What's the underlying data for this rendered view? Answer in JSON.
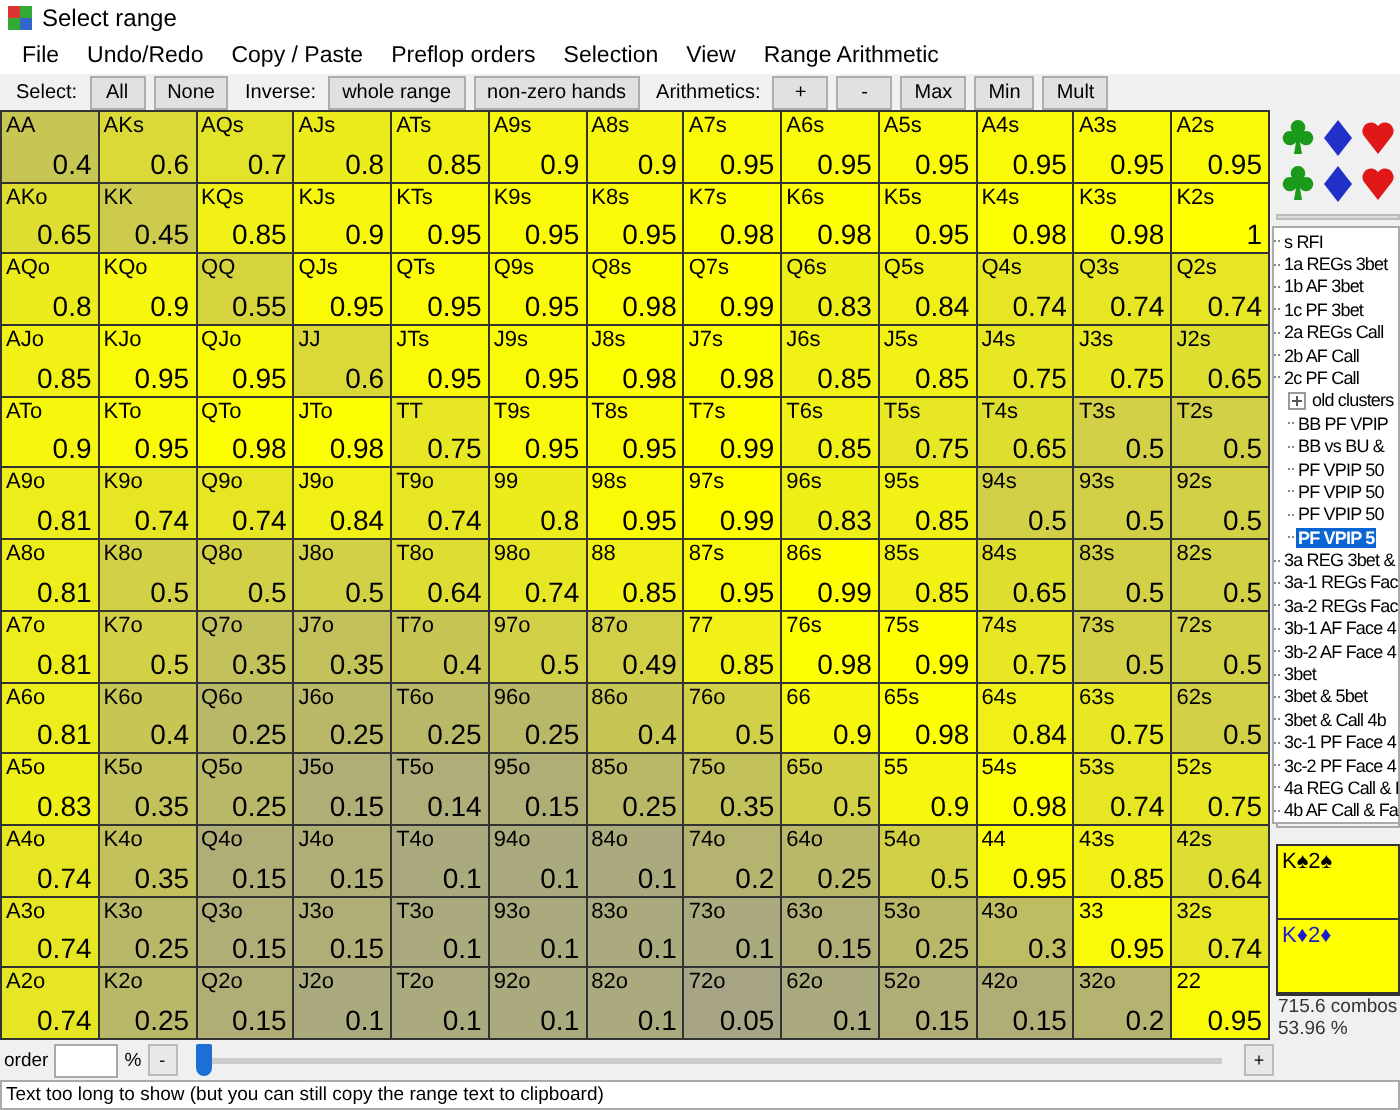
{
  "window": {
    "title": "Select range"
  },
  "menu": [
    "File",
    "Undo/Redo",
    "Copy / Paste",
    "Preflop orders",
    "Selection",
    "View",
    "Range Arithmetic"
  ],
  "toolbar": [
    {
      "label": "Select:",
      "buttons": [
        "All",
        "None"
      ]
    },
    {
      "label": "Inverse:",
      "buttons": [
        "whole range",
        "non-zero hands"
      ]
    },
    {
      "label": "Arithmetics:",
      "buttons": [
        "+",
        "-",
        "Max",
        "Min",
        "Mult"
      ]
    }
  ],
  "grid": [
    [
      {
        "hand": "AA",
        "weight": "0.4",
        "color": "#c7c654"
      },
      {
        "hand": "AKs",
        "weight": "0.6",
        "color": "#dad938"
      },
      {
        "hand": "AQs",
        "weight": "0.7",
        "color": "#e3e32a"
      },
      {
        "hand": "AJs",
        "weight": "0.8",
        "color": "#ecec1c"
      },
      {
        "hand": "ATs",
        "weight": "0.85",
        "color": "#f1f115"
      },
      {
        "hand": "A9s",
        "weight": "0.9",
        "color": "#f6f60e"
      },
      {
        "hand": "A8s",
        "weight": "0.9",
        "color": "#f6f60e"
      },
      {
        "hand": "A7s",
        "weight": "0.95",
        "color": "#fafa07"
      },
      {
        "hand": "A6s",
        "weight": "0.95",
        "color": "#fafa07"
      },
      {
        "hand": "A5s",
        "weight": "0.95",
        "color": "#fafa07"
      },
      {
        "hand": "A4s",
        "weight": "0.95",
        "color": "#fafa07"
      },
      {
        "hand": "A3s",
        "weight": "0.95",
        "color": "#fafa07"
      },
      {
        "hand": "A2s",
        "weight": "0.95",
        "color": "#fafa07"
      }
    ],
    [
      {
        "hand": "AKo",
        "weight": "0.65",
        "color": "#dede31"
      },
      {
        "hand": "KK",
        "weight": "0.45",
        "color": "#cccb4d"
      },
      {
        "hand": "KQs",
        "weight": "0.85",
        "color": "#f1f115"
      },
      {
        "hand": "KJs",
        "weight": "0.9",
        "color": "#f6f60e"
      },
      {
        "hand": "KTs",
        "weight": "0.95",
        "color": "#fafa07"
      },
      {
        "hand": "K9s",
        "weight": "0.95",
        "color": "#fafa07"
      },
      {
        "hand": "K8s",
        "weight": "0.95",
        "color": "#fafa07"
      },
      {
        "hand": "K7s",
        "weight": "0.98",
        "color": "#fdfd03"
      },
      {
        "hand": "K6s",
        "weight": "0.98",
        "color": "#fdfd03"
      },
      {
        "hand": "K5s",
        "weight": "0.95",
        "color": "#fafa07"
      },
      {
        "hand": "K4s",
        "weight": "0.98",
        "color": "#fdfd03"
      },
      {
        "hand": "K3s",
        "weight": "0.98",
        "color": "#fdfd03"
      },
      {
        "hand": "K2s",
        "weight": "1",
        "color": "#ffff00"
      }
    ],
    [
      {
        "hand": "AQo",
        "weight": "0.8",
        "color": "#ecec1c"
      },
      {
        "hand": "KQo",
        "weight": "0.9",
        "color": "#f6f60e"
      },
      {
        "hand": "QQ",
        "weight": "0.55",
        "color": "#d5d43f"
      },
      {
        "hand": "QJs",
        "weight": "0.95",
        "color": "#fafa07"
      },
      {
        "hand": "QTs",
        "weight": "0.95",
        "color": "#fafa07"
      },
      {
        "hand": "Q9s",
        "weight": "0.95",
        "color": "#fafa07"
      },
      {
        "hand": "Q8s",
        "weight": "0.98",
        "color": "#fdfd03"
      },
      {
        "hand": "Q7s",
        "weight": "0.99",
        "color": "#fefe01"
      },
      {
        "hand": "Q6s",
        "weight": "0.83",
        "color": "#efef18"
      },
      {
        "hand": "Q5s",
        "weight": "0.84",
        "color": "#f0f016"
      },
      {
        "hand": "Q4s",
        "weight": "0.74",
        "color": "#e7e624"
      },
      {
        "hand": "Q3s",
        "weight": "0.74",
        "color": "#e7e624"
      },
      {
        "hand": "Q2s",
        "weight": "0.74",
        "color": "#e7e624"
      }
    ],
    [
      {
        "hand": "AJo",
        "weight": "0.85",
        "color": "#f1f115"
      },
      {
        "hand": "KJo",
        "weight": "0.95",
        "color": "#fafa07"
      },
      {
        "hand": "QJo",
        "weight": "0.95",
        "color": "#fafa07"
      },
      {
        "hand": "JJ",
        "weight": "0.6",
        "color": "#dad938"
      },
      {
        "hand": "JTs",
        "weight": "0.95",
        "color": "#fafa07"
      },
      {
        "hand": "J9s",
        "weight": "0.95",
        "color": "#fafa07"
      },
      {
        "hand": "J8s",
        "weight": "0.98",
        "color": "#fdfd03"
      },
      {
        "hand": "J7s",
        "weight": "0.98",
        "color": "#fdfd03"
      },
      {
        "hand": "J6s",
        "weight": "0.85",
        "color": "#f1f115"
      },
      {
        "hand": "J5s",
        "weight": "0.85",
        "color": "#f1f115"
      },
      {
        "hand": "J4s",
        "weight": "0.75",
        "color": "#e8e723"
      },
      {
        "hand": "J3s",
        "weight": "0.75",
        "color": "#e8e723"
      },
      {
        "hand": "J2s",
        "weight": "0.65",
        "color": "#dede31"
      }
    ],
    [
      {
        "hand": "ATo",
        "weight": "0.9",
        "color": "#f6f60e"
      },
      {
        "hand": "KTo",
        "weight": "0.95",
        "color": "#fafa07"
      },
      {
        "hand": "QTo",
        "weight": "0.98",
        "color": "#fdfd03"
      },
      {
        "hand": "JTo",
        "weight": "0.98",
        "color": "#fdfd03"
      },
      {
        "hand": "TT",
        "weight": "0.75",
        "color": "#e8e723"
      },
      {
        "hand": "T9s",
        "weight": "0.95",
        "color": "#fafa07"
      },
      {
        "hand": "T8s",
        "weight": "0.95",
        "color": "#fafa07"
      },
      {
        "hand": "T7s",
        "weight": "0.99",
        "color": "#fefe01"
      },
      {
        "hand": "T6s",
        "weight": "0.85",
        "color": "#f1f115"
      },
      {
        "hand": "T5s",
        "weight": "0.75",
        "color": "#e8e723"
      },
      {
        "hand": "T4s",
        "weight": "0.65",
        "color": "#dede31"
      },
      {
        "hand": "T3s",
        "weight": "0.5",
        "color": "#d1d046"
      },
      {
        "hand": "T2s",
        "weight": "0.5",
        "color": "#d1d046"
      }
    ],
    [
      {
        "hand": "A9o",
        "weight": "0.81",
        "color": "#eded1b"
      },
      {
        "hand": "K9o",
        "weight": "0.74",
        "color": "#e7e624"
      },
      {
        "hand": "Q9o",
        "weight": "0.74",
        "color": "#e7e624"
      },
      {
        "hand": "J9o",
        "weight": "0.84",
        "color": "#f0f016"
      },
      {
        "hand": "T9o",
        "weight": "0.74",
        "color": "#e7e624"
      },
      {
        "hand": "99",
        "weight": "0.8",
        "color": "#ecec1c"
      },
      {
        "hand": "98s",
        "weight": "0.95",
        "color": "#fafa07"
      },
      {
        "hand": "97s",
        "weight": "0.99",
        "color": "#fefe01"
      },
      {
        "hand": "96s",
        "weight": "0.83",
        "color": "#efef18"
      },
      {
        "hand": "95s",
        "weight": "0.85",
        "color": "#f1f115"
      },
      {
        "hand": "94s",
        "weight": "0.5",
        "color": "#d1d046"
      },
      {
        "hand": "93s",
        "weight": "0.5",
        "color": "#d1d046"
      },
      {
        "hand": "92s",
        "weight": "0.5",
        "color": "#d1d046"
      }
    ],
    [
      {
        "hand": "A8o",
        "weight": "0.81",
        "color": "#eded1b"
      },
      {
        "hand": "K8o",
        "weight": "0.5",
        "color": "#d1d046"
      },
      {
        "hand": "Q8o",
        "weight": "0.5",
        "color": "#d1d046"
      },
      {
        "hand": "J8o",
        "weight": "0.5",
        "color": "#d1d046"
      },
      {
        "hand": "T8o",
        "weight": "0.64",
        "color": "#dedd32"
      },
      {
        "hand": "98o",
        "weight": "0.74",
        "color": "#e7e624"
      },
      {
        "hand": "88",
        "weight": "0.85",
        "color": "#f1f115"
      },
      {
        "hand": "87s",
        "weight": "0.95",
        "color": "#fafa07"
      },
      {
        "hand": "86s",
        "weight": "0.99",
        "color": "#fefe01"
      },
      {
        "hand": "85s",
        "weight": "0.85",
        "color": "#f1f115"
      },
      {
        "hand": "84s",
        "weight": "0.65",
        "color": "#dede31"
      },
      {
        "hand": "83s",
        "weight": "0.5",
        "color": "#d1d046"
      },
      {
        "hand": "82s",
        "weight": "0.5",
        "color": "#d1d046"
      }
    ],
    [
      {
        "hand": "A7o",
        "weight": "0.81",
        "color": "#eded1b"
      },
      {
        "hand": "K7o",
        "weight": "0.5",
        "color": "#d1d046"
      },
      {
        "hand": "Q7o",
        "weight": "0.35",
        "color": "#c3c15b"
      },
      {
        "hand": "J7o",
        "weight": "0.35",
        "color": "#c3c15b"
      },
      {
        "hand": "T7o",
        "weight": "0.4",
        "color": "#c7c654"
      },
      {
        "hand": "97o",
        "weight": "0.5",
        "color": "#d1d046"
      },
      {
        "hand": "87o",
        "weight": "0.49",
        "color": "#d0cf47"
      },
      {
        "hand": "77",
        "weight": "0.85",
        "color": "#f1f115"
      },
      {
        "hand": "76s",
        "weight": "0.98",
        "color": "#fdfd03"
      },
      {
        "hand": "75s",
        "weight": "0.99",
        "color": "#fefe01"
      },
      {
        "hand": "74s",
        "weight": "0.75",
        "color": "#e8e723"
      },
      {
        "hand": "73s",
        "weight": "0.5",
        "color": "#d1d046"
      },
      {
        "hand": "72s",
        "weight": "0.5",
        "color": "#d1d046"
      }
    ],
    [
      {
        "hand": "A6o",
        "weight": "0.81",
        "color": "#eded1b"
      },
      {
        "hand": "K6o",
        "weight": "0.4",
        "color": "#c7c654"
      },
      {
        "hand": "Q6o",
        "weight": "0.25",
        "color": "#b9b869"
      },
      {
        "hand": "J6o",
        "weight": "0.25",
        "color": "#b9b869"
      },
      {
        "hand": "T6o",
        "weight": "0.25",
        "color": "#b9b869"
      },
      {
        "hand": "96o",
        "weight": "0.25",
        "color": "#b9b869"
      },
      {
        "hand": "86o",
        "weight": "0.4",
        "color": "#c7c654"
      },
      {
        "hand": "76o",
        "weight": "0.5",
        "color": "#d1d046"
      },
      {
        "hand": "66",
        "weight": "0.9",
        "color": "#f6f60e"
      },
      {
        "hand": "65s",
        "weight": "0.98",
        "color": "#fdfd03"
      },
      {
        "hand": "64s",
        "weight": "0.84",
        "color": "#f0f016"
      },
      {
        "hand": "63s",
        "weight": "0.75",
        "color": "#e8e723"
      },
      {
        "hand": "62s",
        "weight": "0.5",
        "color": "#d1d046"
      }
    ],
    [
      {
        "hand": "A5o",
        "weight": "0.83",
        "color": "#efef18"
      },
      {
        "hand": "K5o",
        "weight": "0.35",
        "color": "#c3c15b"
      },
      {
        "hand": "Q5o",
        "weight": "0.25",
        "color": "#b9b869"
      },
      {
        "hand": "J5o",
        "weight": "0.15",
        "color": "#b0ae77"
      },
      {
        "hand": "T5o",
        "weight": "0.14",
        "color": "#afad78"
      },
      {
        "hand": "95o",
        "weight": "0.15",
        "color": "#b0ae77"
      },
      {
        "hand": "85o",
        "weight": "0.25",
        "color": "#b9b869"
      },
      {
        "hand": "75o",
        "weight": "0.35",
        "color": "#c3c15b"
      },
      {
        "hand": "65o",
        "weight": "0.5",
        "color": "#d1d046"
      },
      {
        "hand": "55",
        "weight": "0.9",
        "color": "#f6f60e"
      },
      {
        "hand": "54s",
        "weight": "0.98",
        "color": "#fdfd03"
      },
      {
        "hand": "53s",
        "weight": "0.74",
        "color": "#e7e624"
      },
      {
        "hand": "52s",
        "weight": "0.75",
        "color": "#e8e723"
      }
    ],
    [
      {
        "hand": "A4o",
        "weight": "0.74",
        "color": "#e7e624"
      },
      {
        "hand": "K4o",
        "weight": "0.35",
        "color": "#c3c15b"
      },
      {
        "hand": "Q4o",
        "weight": "0.15",
        "color": "#b0ae77"
      },
      {
        "hand": "J4o",
        "weight": "0.15",
        "color": "#b0ae77"
      },
      {
        "hand": "T4o",
        "weight": "0.1",
        "color": "#abaa7e"
      },
      {
        "hand": "94o",
        "weight": "0.1",
        "color": "#abaa7e"
      },
      {
        "hand": "84o",
        "weight": "0.1",
        "color": "#abaa7e"
      },
      {
        "hand": "74o",
        "weight": "0.2",
        "color": "#b5b370"
      },
      {
        "hand": "64o",
        "weight": "0.25",
        "color": "#b9b869"
      },
      {
        "hand": "54o",
        "weight": "0.5",
        "color": "#d1d046"
      },
      {
        "hand": "44",
        "weight": "0.95",
        "color": "#fafa07"
      },
      {
        "hand": "43s",
        "weight": "0.85",
        "color": "#f1f115"
      },
      {
        "hand": "42s",
        "weight": "0.64",
        "color": "#dedd32"
      }
    ],
    [
      {
        "hand": "A3o",
        "weight": "0.74",
        "color": "#e7e624"
      },
      {
        "hand": "K3o",
        "weight": "0.25",
        "color": "#b9b869"
      },
      {
        "hand": "Q3o",
        "weight": "0.15",
        "color": "#b0ae77"
      },
      {
        "hand": "J3o",
        "weight": "0.15",
        "color": "#b0ae77"
      },
      {
        "hand": "T3o",
        "weight": "0.1",
        "color": "#abaa7e"
      },
      {
        "hand": "93o",
        "weight": "0.1",
        "color": "#abaa7e"
      },
      {
        "hand": "83o",
        "weight": "0.1",
        "color": "#abaa7e"
      },
      {
        "hand": "73o",
        "weight": "0.1",
        "color": "#abaa7e"
      },
      {
        "hand": "63o",
        "weight": "0.15",
        "color": "#b0ae77"
      },
      {
        "hand": "53o",
        "weight": "0.25",
        "color": "#b9b869"
      },
      {
        "hand": "43o",
        "weight": "0.3",
        "color": "#bebd62"
      },
      {
        "hand": "33",
        "weight": "0.95",
        "color": "#fafa07"
      },
      {
        "hand": "32s",
        "weight": "0.74",
        "color": "#e7e624"
      }
    ],
    [
      {
        "hand": "A2o",
        "weight": "0.74",
        "color": "#e7e624"
      },
      {
        "hand": "K2o",
        "weight": "0.25",
        "color": "#b9b869"
      },
      {
        "hand": "Q2o",
        "weight": "0.15",
        "color": "#b0ae77"
      },
      {
        "hand": "J2o",
        "weight": "0.1",
        "color": "#abaa7e"
      },
      {
        "hand": "T2o",
        "weight": "0.1",
        "color": "#abaa7e"
      },
      {
        "hand": "92o",
        "weight": "0.1",
        "color": "#abaa7e"
      },
      {
        "hand": "82o",
        "weight": "0.1",
        "color": "#abaa7e"
      },
      {
        "hand": "72o",
        "weight": "0.05",
        "color": "#a7a585"
      },
      {
        "hand": "62o",
        "weight": "0.1",
        "color": "#abaa7e"
      },
      {
        "hand": "52o",
        "weight": "0.15",
        "color": "#b0ae77"
      },
      {
        "hand": "42o",
        "weight": "0.15",
        "color": "#b0ae77"
      },
      {
        "hand": "32o",
        "weight": "0.2",
        "color": "#b5b370"
      },
      {
        "hand": "22",
        "weight": "0.95",
        "color": "#fafa07"
      }
    ]
  ],
  "bottom": {
    "label": "order",
    "unit": "%",
    "minus": "-",
    "plus": "+",
    "level": 0
  },
  "status_bar": "Text too long to show (but you can still copy the range text to clipboard)",
  "tree": [
    {
      "label": "s RFI",
      "selected": false
    },
    {
      "label": "1a REGs 3bet",
      "selected": false
    },
    {
      "label": "1b AF 3bet",
      "selected": false
    },
    {
      "label": "1c PF 3bet",
      "selected": false
    },
    {
      "label": "2a REGs Call",
      "selected": false
    },
    {
      "label": "2b AF Call",
      "selected": false
    },
    {
      "label": "2c PF Call",
      "selected": false,
      "children": [
        {
          "label": "old clusters",
          "selected": false,
          "expanded": false
        },
        {
          "label": "BB PF VPIP",
          "selected": false
        },
        {
          "label": "BB vs BU &",
          "selected": false
        },
        {
          "label": "PF VPIP 50",
          "selected": false
        },
        {
          "label": "PF VPIP 50",
          "selected": false
        },
        {
          "label": "PF VPIP 50",
          "selected": false
        },
        {
          "label": "PF VPIP 5",
          "selected": true
        }
      ]
    },
    {
      "label": "3a REG 3bet &",
      "selected": false
    },
    {
      "label": "3a-1 REGs Fac",
      "selected": false
    },
    {
      "label": "3a-2 REGs Fac",
      "selected": false
    },
    {
      "label": "3b-1 AF Face 4",
      "selected": false
    },
    {
      "label": "3b-2 AF Face 4",
      "selected": false
    },
    {
      "label": "3bet",
      "selected": false
    },
    {
      "label": "3bet & 5bet",
      "selected": false
    },
    {
      "label": "3bet & Call 4b",
      "selected": false
    },
    {
      "label": "3c-1 PF Face 4",
      "selected": false
    },
    {
      "label": "3c-2 PF Face 4",
      "selected": false
    },
    {
      "label": "4a REG Call & I",
      "selected": false
    },
    {
      "label": "4b AF Call & Fa",
      "selected": false
    }
  ],
  "hands": [
    {
      "text": "K♠2♠",
      "color": "#000000"
    },
    {
      "text": "K♦2♦",
      "color": "#1a1ad0"
    }
  ],
  "combos": [
    "715.6 combos",
    "53.96 %"
  ]
}
